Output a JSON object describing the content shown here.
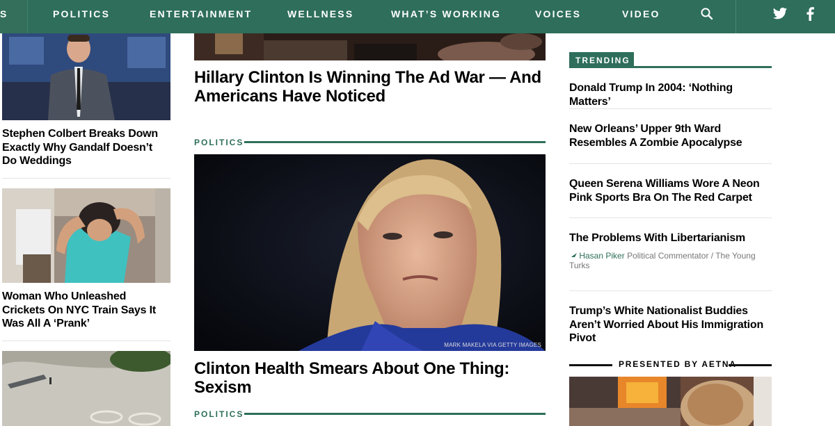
{
  "nav": {
    "items": [
      "POLITICS",
      "ENTERTAINMENT",
      "WELLNESS",
      "WHAT’S WORKING",
      "VOICES",
      "VIDEO"
    ],
    "stub_label": "S",
    "icons": [
      "search-icon",
      "twitter-icon",
      "facebook-icon"
    ]
  },
  "left": {
    "stories": [
      {
        "title": "Stephen Colbert Breaks Down Exactly Why Gandalf Doesn’t Do Weddings"
      },
      {
        "title": "Woman Who Unleashed Crickets On NYC Train Says It Was All A ‘Prank’"
      }
    ]
  },
  "middle": {
    "top_story_title": "Hillary Clinton Is Winning The Ad War — And Americans Have Noticed",
    "section_label_1": "POLITICS",
    "photo_credit": "MARK MAKELA VIA GETTY IMAGES",
    "main_story_title": "Clinton Health Smears About One Thing: Sexism",
    "section_label_2": "POLITICS"
  },
  "trending": {
    "label": "TRENDING",
    "items": [
      {
        "title": "Donald Trump In 2004: ‘Nothing Matters’"
      },
      {
        "title": "New Orleans’ Upper 9th Ward Resembles A Zombie Apocalypse"
      },
      {
        "title": "Queen Serena Williams Wore A Neon Pink Sports Bra On The Red Carpet"
      },
      {
        "title": "The Problems With Libertarianism",
        "author": "Hasan Piker",
        "author_desc": "Political Commentator / The Young Turks"
      },
      {
        "title": "Trump’s White Nationalist Buddies Aren’t Worried About His Immigration Pivot"
      }
    ]
  },
  "presented_by": "PRESENTED BY AETNA",
  "colors": {
    "brand_green": "#2e6e5a",
    "text": "#000000",
    "divider": "#e3e3e3"
  }
}
